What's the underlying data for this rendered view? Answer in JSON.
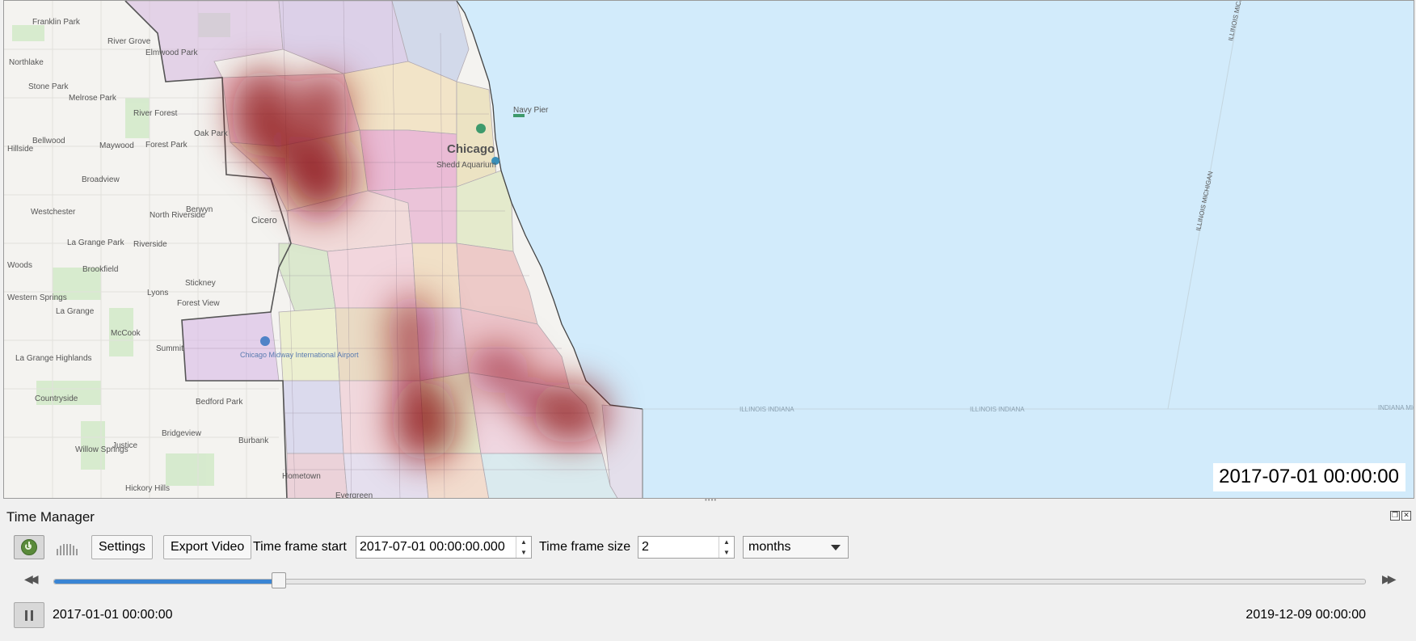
{
  "map": {
    "timestamp": "2017-07-01 00:00:00",
    "labels": {
      "franklin_park": "Franklin Park",
      "river_grove": "River Grove",
      "elmwood_park": "Elmwood Park",
      "northlake": "Northlake",
      "stone_park": "Stone Park",
      "melrose_park": "Melrose Park",
      "river_forest": "River Forest",
      "oak_park": "Oak Park",
      "bellwood": "Bellwood",
      "maywood": "Maywood",
      "forest_park": "Forest Park",
      "hillside": "Hillside",
      "broadview": "Broadview",
      "westchester": "Westchester",
      "north_riverside": "North Riverside",
      "berwyn": "Berwyn",
      "cicero": "Cicero",
      "la_grange_park": "La Grange Park",
      "riverside": "Riverside",
      "brookfield": "Brookfield",
      "lyons": "Lyons",
      "stickney": "Stickney",
      "forest_view": "Forest View",
      "la_grange": "La Grange",
      "western_springs": "Western Springs",
      "mccook": "McCook",
      "summit": "Summit",
      "la_grange_highlands": "La Grange Highlands",
      "countryside": "Countryside",
      "bedford_park": "Bedford Park",
      "bridgeview": "Bridgeview",
      "burbank": "Burbank",
      "willow_springs": "Willow Springs",
      "justice": "Justice",
      "hickory_hills": "Hickory Hills",
      "hometown": "Hometown",
      "evergreen": "Evergreen",
      "chicago": "Chicago",
      "navy_pier": "Navy Pier",
      "shedd_aquarium": "Shedd Aquarium",
      "chicago_midway": "Chicago Midway International Airport",
      "woods": "Woods",
      "illinois_indiana": "ILLINOIS INDIANA",
      "illinois_michigan": "ILLINOIS MICHIGAN",
      "indiana_michigan": "INDIANA MICHIGAN"
    }
  },
  "panel": {
    "title": "Time Manager",
    "settings_label": "Settings",
    "export_label": "Export Video",
    "time_frame_start_label": "Time frame start",
    "time_frame_start_value": "2017-07-01 00:00:00.000",
    "time_frame_size_label": "Time frame size",
    "time_frame_size_value": "2",
    "unit_value": "months",
    "slider_progress": 0.172,
    "start_date": "2017-01-01 00:00:00",
    "end_date": "2019-12-09 00:00:00"
  },
  "colors": {
    "lake": "#d2ebfb",
    "heat": "#8b0a14",
    "slider_fill": "#3a85d4"
  }
}
